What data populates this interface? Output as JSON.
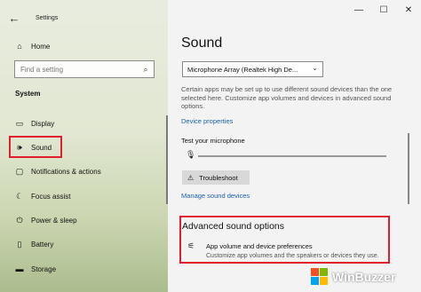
{
  "window": {
    "title": "Settings",
    "back_icon": "←",
    "controls": [
      "—",
      "☐",
      "✕"
    ]
  },
  "sidebar": {
    "home_label": "Home",
    "search_placeholder": "Find a setting",
    "section_label": "System",
    "items": [
      {
        "label": "Display",
        "icon": "display-icon"
      },
      {
        "label": "Sound",
        "icon": "speaker-icon",
        "selected": true
      },
      {
        "label": "Notifications & actions",
        "icon": "notifications-icon"
      },
      {
        "label": "Focus assist",
        "icon": "moon-icon"
      },
      {
        "label": "Power & sleep",
        "icon": "power-icon"
      },
      {
        "label": "Battery",
        "icon": "battery-icon"
      },
      {
        "label": "Storage",
        "icon": "storage-icon"
      }
    ]
  },
  "main": {
    "title": "Sound",
    "input_device": "Microphone Array (Realtek High De...",
    "description": "Certain apps may be set up to use different sound devices than the one selected here. Customize app volumes and devices in advanced sound options.",
    "device_properties_link": "Device properties",
    "test_mic_label": "Test your microphone",
    "mic_level": 0.0,
    "troubleshoot_label": "Troubleshoot",
    "manage_devices_link": "Manage sound devices",
    "advanced": {
      "title": "Advanced sound options",
      "item_title": "App volume and device preferences",
      "item_desc": "Customize app volumes and the speakers or devices they use."
    }
  },
  "watermark": {
    "text": "WinBuzzer"
  },
  "colors": {
    "highlight": "#e01e2e",
    "link": "#1a5fb4"
  }
}
